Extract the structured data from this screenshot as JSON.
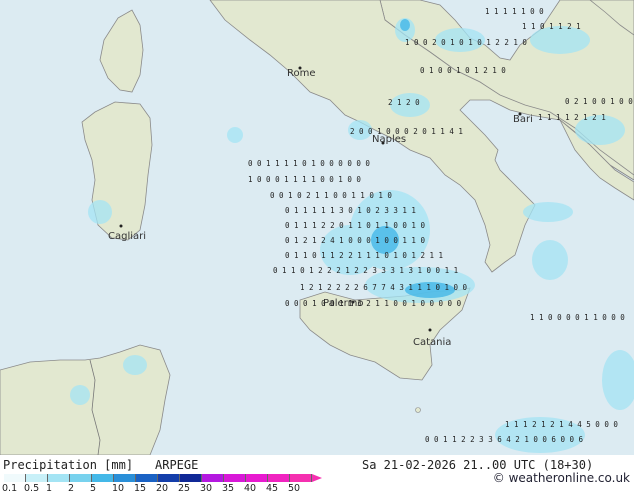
{
  "title": "Precipitation [mm]",
  "model": "ARPEGE",
  "valid_time": "Sa 21-02-2026 21..00 UTC (18+30)",
  "credit": "© weatheronline.co.uk",
  "legend": {
    "ticks": [
      "0.1",
      "0.5",
      "1",
      "2",
      "5",
      "10",
      "15",
      "20",
      "25",
      "30",
      "35",
      "40",
      "45",
      "50"
    ],
    "colors": [
      "#f0fafc",
      "#c8f0f8",
      "#a4e4f4",
      "#78d2ee",
      "#44b8e8",
      "#2a8fd8",
      "#1a62c4",
      "#143eaa",
      "#102896",
      "#b418e0",
      "#d818d8",
      "#e81ad0",
      "#f024c0",
      "#f530b0"
    ]
  },
  "colors": {
    "sea": "#dcebf2",
    "land": "#e2e8d0",
    "land_dark": "#cfd9b4",
    "border": "#7a7a7a"
  },
  "cities": [
    {
      "name": "Rome"
    },
    {
      "name": "Naples"
    },
    {
      "name": "Bari"
    },
    {
      "name": "Cagliari"
    },
    {
      "name": "Palermo"
    },
    {
      "name": "Catania"
    }
  ],
  "grid_rows": [
    "1 1 1 1 1 0 0",
    "1 1 0 1 1 2 1",
    "1 0 0 2 0 1 0 1 0 1 2 2 1 0",
    "0 1 0 0 1 0 1 2 1 0",
    "2 1 2 0",
    "0 2 1 0 0 1 0 0 1",
    "1 1 1 1 2 1 2 1",
    "2 0 0 1 0 0 0 2 0 1 1 4 1",
    "0 0 1 1 1 1 0 1 0 0 0 0 0 0",
    "1 0 0 0 1 1 1 1 0 0 1 0 0",
    "0 0 1 0 2 1 1 0 0 1 1 0 1 0",
    "0 1 1 1 1 1 3 0 1 0 2 3 3 1 1",
    "0 1 1 1 2 2 0 1 1 0 1 1 0 0 1 0",
    "0 1 2 1 2 4 1 0 0 0 1 0 0 1 1 0",
    "0 1 1 0 1 1 2 2 1 1 1 0 1 0 1 2 1 1",
    "0 1 1 0 1 2 2 2 1 2 2 3 3 3 1 3 1 0 0 1 1",
    "1 2 1 2 2 2 2 6 7 7 4 3 1 1 1 0 1 0 0",
    "0 0 0 1 0 0 1 1 3 2 1 1 0 0 1 0 0 0 0 0",
    "1 1 0 0 0 0 1 1 0 0 0",
    "1 1 1 2 1 2 1 4 4 5 0 0 0",
    "0 0 1 1 2 2 3 3 6 4 2 1 0 0 6 0 0 6"
  ]
}
